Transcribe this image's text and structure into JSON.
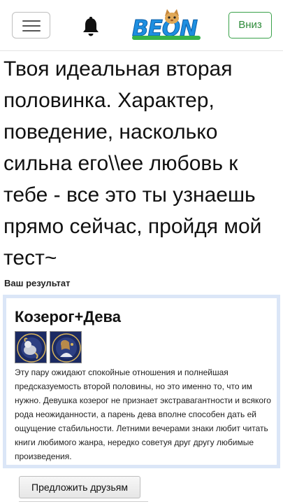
{
  "header": {
    "menu_icon": "hamburger-menu-icon",
    "notification_icon": "bell-icon",
    "logo": {
      "text": "BEON",
      "accent_color": "#1e8fe0",
      "leaf_color": "#37b34a"
    },
    "down_button_label": "Вниз",
    "down_button_color": "#2e8b3a"
  },
  "test": {
    "title": "Твоя идеальная вторая половинка. Характер, поведение, насколько сильна его\\\\ее любовь к тебе - все это ты узнаешь прямо сейчас, пройдя мой тест~"
  },
  "result": {
    "label": "Ваш результат",
    "heading": "Козерог+Дева",
    "images": [
      "capricorn-zodiac-image",
      "virgo-zodiac-image"
    ],
    "description": "Эту пару ожидают спокойные отношения и полнейшая предсказуемость второй половины, но это именно то, что им нужно. Девушка козерог не признает экстравагантности и всякого рода неожиданности, а парень дева вполне способен дать ей ощущение стабильности. Летними вечерами знаки любит читать книги любимого жанра, нередко советуя друг другу любимые произведения.",
    "border_color": "#dbe6f7"
  },
  "actions": {
    "share_label": "Предложить друзьям"
  }
}
